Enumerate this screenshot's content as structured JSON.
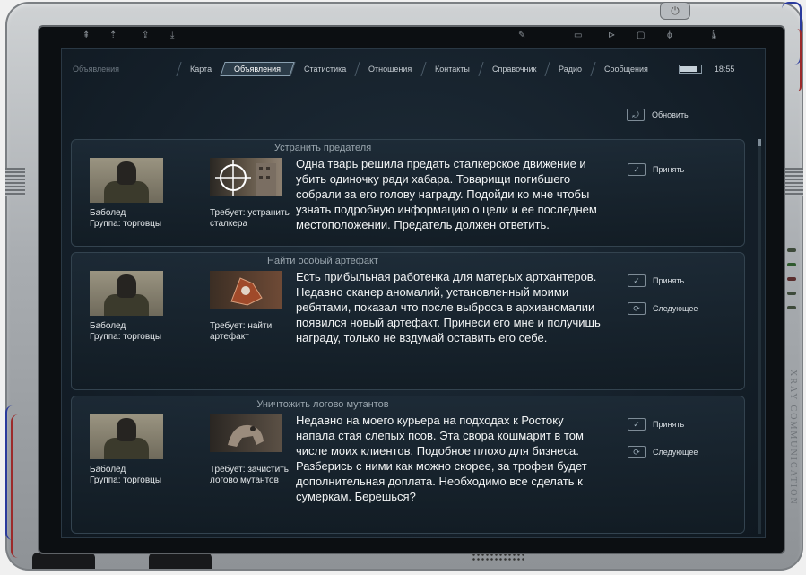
{
  "device": {
    "brand": "XRAY COMMUNICATION",
    "power_icon": "power-icon",
    "accent": "#8aa0b0",
    "screen_bg": "#15202a"
  },
  "header": {
    "section_title": "Объявления",
    "tabs": [
      {
        "label": "Карта"
      },
      {
        "label": "Объявления",
        "active": true
      },
      {
        "label": "Статистика"
      },
      {
        "label": "Отношения"
      },
      {
        "label": "Контакты"
      },
      {
        "label": "Справочник"
      },
      {
        "label": "Радио"
      },
      {
        "label": "Сообщения"
      }
    ],
    "time": "18:55"
  },
  "refresh_label": "Обновить",
  "tasks": [
    {
      "title": "Устранить предателя",
      "giver_name": "Баболед",
      "giver_group": "Группа: торговцы",
      "requirement": "Требует: устранить сталкера",
      "description": "Одна тварь решила предать сталкерское движение и убить одиночку ради хабара. Товарищи погибшего собрали за его голову награду. Подойди ко мне чтобы узнать подробную информацию о цели и ее последнем местоположении. Предатель должен ответить.",
      "accept": "Принять"
    },
    {
      "title": "Найти особый артефакт",
      "giver_name": "Баболед",
      "giver_group": "Группа: торговцы",
      "requirement": "Требует: найти артефакт",
      "description": "Есть прибыльная работенка для матерых артхантеров. Недавно сканер аномалий, установленный моими ребятами, показал что после выброса в архианомалии появился новый артефакт. Принеси его мне и получишь награду, только не вздумай оставить его себе.",
      "accept": "Принять",
      "next": "Следующее"
    },
    {
      "title": "Уничтожить логово мутантов",
      "giver_name": "Баболед",
      "giver_group": "Группа: торговцы",
      "requirement": "Требует: зачистить логово мутантов",
      "description": "Недавно на моего курьера на подходах к Ростоку напала стая слепых псов. Эта свора кошмарит в том числе моих клиентов. Подобное плохо для бизнеса. Разберись с ними как можно скорее, за трофеи будет дополнительная доплата. Необходимо все сделать к сумеркам. Берешься?",
      "accept": "Принять",
      "next": "Следующее"
    }
  ]
}
